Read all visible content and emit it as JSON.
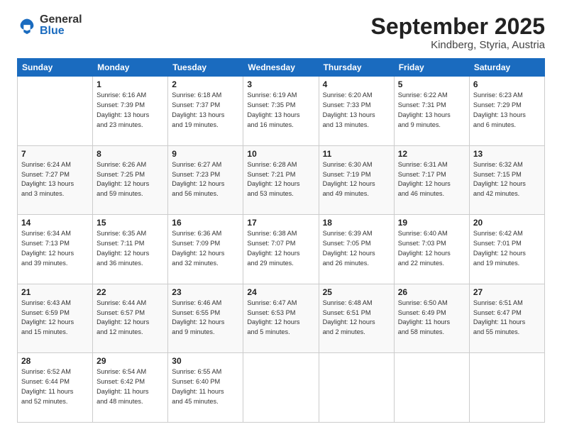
{
  "logo": {
    "general": "General",
    "blue": "Blue"
  },
  "header": {
    "month": "September 2025",
    "location": "Kindberg, Styria, Austria"
  },
  "weekdays": [
    "Sunday",
    "Monday",
    "Tuesday",
    "Wednesday",
    "Thursday",
    "Friday",
    "Saturday"
  ],
  "weeks": [
    [
      {
        "day": "",
        "info": ""
      },
      {
        "day": "1",
        "info": "Sunrise: 6:16 AM\nSunset: 7:39 PM\nDaylight: 13 hours\nand 23 minutes."
      },
      {
        "day": "2",
        "info": "Sunrise: 6:18 AM\nSunset: 7:37 PM\nDaylight: 13 hours\nand 19 minutes."
      },
      {
        "day": "3",
        "info": "Sunrise: 6:19 AM\nSunset: 7:35 PM\nDaylight: 13 hours\nand 16 minutes."
      },
      {
        "day": "4",
        "info": "Sunrise: 6:20 AM\nSunset: 7:33 PM\nDaylight: 13 hours\nand 13 minutes."
      },
      {
        "day": "5",
        "info": "Sunrise: 6:22 AM\nSunset: 7:31 PM\nDaylight: 13 hours\nand 9 minutes."
      },
      {
        "day": "6",
        "info": "Sunrise: 6:23 AM\nSunset: 7:29 PM\nDaylight: 13 hours\nand 6 minutes."
      }
    ],
    [
      {
        "day": "7",
        "info": "Sunrise: 6:24 AM\nSunset: 7:27 PM\nDaylight: 13 hours\nand 3 minutes."
      },
      {
        "day": "8",
        "info": "Sunrise: 6:26 AM\nSunset: 7:25 PM\nDaylight: 12 hours\nand 59 minutes."
      },
      {
        "day": "9",
        "info": "Sunrise: 6:27 AM\nSunset: 7:23 PM\nDaylight: 12 hours\nand 56 minutes."
      },
      {
        "day": "10",
        "info": "Sunrise: 6:28 AM\nSunset: 7:21 PM\nDaylight: 12 hours\nand 53 minutes."
      },
      {
        "day": "11",
        "info": "Sunrise: 6:30 AM\nSunset: 7:19 PM\nDaylight: 12 hours\nand 49 minutes."
      },
      {
        "day": "12",
        "info": "Sunrise: 6:31 AM\nSunset: 7:17 PM\nDaylight: 12 hours\nand 46 minutes."
      },
      {
        "day": "13",
        "info": "Sunrise: 6:32 AM\nSunset: 7:15 PM\nDaylight: 12 hours\nand 42 minutes."
      }
    ],
    [
      {
        "day": "14",
        "info": "Sunrise: 6:34 AM\nSunset: 7:13 PM\nDaylight: 12 hours\nand 39 minutes."
      },
      {
        "day": "15",
        "info": "Sunrise: 6:35 AM\nSunset: 7:11 PM\nDaylight: 12 hours\nand 36 minutes."
      },
      {
        "day": "16",
        "info": "Sunrise: 6:36 AM\nSunset: 7:09 PM\nDaylight: 12 hours\nand 32 minutes."
      },
      {
        "day": "17",
        "info": "Sunrise: 6:38 AM\nSunset: 7:07 PM\nDaylight: 12 hours\nand 29 minutes."
      },
      {
        "day": "18",
        "info": "Sunrise: 6:39 AM\nSunset: 7:05 PM\nDaylight: 12 hours\nand 26 minutes."
      },
      {
        "day": "19",
        "info": "Sunrise: 6:40 AM\nSunset: 7:03 PM\nDaylight: 12 hours\nand 22 minutes."
      },
      {
        "day": "20",
        "info": "Sunrise: 6:42 AM\nSunset: 7:01 PM\nDaylight: 12 hours\nand 19 minutes."
      }
    ],
    [
      {
        "day": "21",
        "info": "Sunrise: 6:43 AM\nSunset: 6:59 PM\nDaylight: 12 hours\nand 15 minutes."
      },
      {
        "day": "22",
        "info": "Sunrise: 6:44 AM\nSunset: 6:57 PM\nDaylight: 12 hours\nand 12 minutes."
      },
      {
        "day": "23",
        "info": "Sunrise: 6:46 AM\nSunset: 6:55 PM\nDaylight: 12 hours\nand 9 minutes."
      },
      {
        "day": "24",
        "info": "Sunrise: 6:47 AM\nSunset: 6:53 PM\nDaylight: 12 hours\nand 5 minutes."
      },
      {
        "day": "25",
        "info": "Sunrise: 6:48 AM\nSunset: 6:51 PM\nDaylight: 12 hours\nand 2 minutes."
      },
      {
        "day": "26",
        "info": "Sunrise: 6:50 AM\nSunset: 6:49 PM\nDaylight: 11 hours\nand 58 minutes."
      },
      {
        "day": "27",
        "info": "Sunrise: 6:51 AM\nSunset: 6:47 PM\nDaylight: 11 hours\nand 55 minutes."
      }
    ],
    [
      {
        "day": "28",
        "info": "Sunrise: 6:52 AM\nSunset: 6:44 PM\nDaylight: 11 hours\nand 52 minutes."
      },
      {
        "day": "29",
        "info": "Sunrise: 6:54 AM\nSunset: 6:42 PM\nDaylight: 11 hours\nand 48 minutes."
      },
      {
        "day": "30",
        "info": "Sunrise: 6:55 AM\nSunset: 6:40 PM\nDaylight: 11 hours\nand 45 minutes."
      },
      {
        "day": "",
        "info": ""
      },
      {
        "day": "",
        "info": ""
      },
      {
        "day": "",
        "info": ""
      },
      {
        "day": "",
        "info": ""
      }
    ]
  ]
}
